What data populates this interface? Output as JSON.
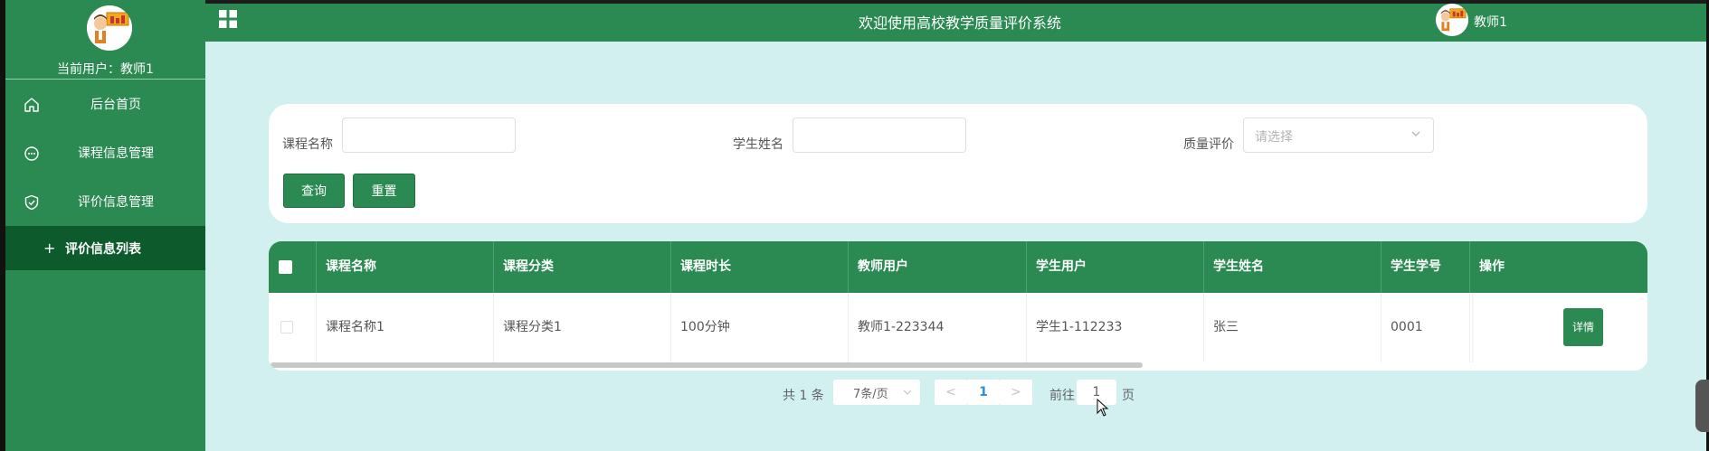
{
  "sidebar": {
    "current_user_label": "当前用户：教师1",
    "items": [
      {
        "label": "后台首页",
        "icon": "home-icon"
      },
      {
        "label": "课程信息管理",
        "icon": "chat-bubble-icon"
      },
      {
        "label": "评价信息管理",
        "icon": "shield-check-icon"
      }
    ],
    "sub_item": {
      "label": "评价信息列表",
      "prefix": "+"
    }
  },
  "header": {
    "title": "欢迎使用高校教学质量评价系统",
    "user_name": "教师1"
  },
  "search": {
    "course_name_label": "课程名称",
    "course_name_value": "",
    "student_name_label": "学生姓名",
    "student_name_value": "",
    "quality_label": "质量评价",
    "quality_placeholder": "请选择",
    "query_button": "查询",
    "reset_button": "重置"
  },
  "table": {
    "columns": [
      "课程名称",
      "课程分类",
      "课程时长",
      "教师用户",
      "学生用户",
      "学生姓名",
      "学生学号",
      "操作"
    ],
    "rows": [
      {
        "course_name": "课程名称1",
        "course_category": "课程分类1",
        "course_duration": "100分钟",
        "teacher_user": "教师1-223344",
        "student_user": "学生1-112233",
        "student_name": "张三",
        "student_no": "0001",
        "action": "详情"
      }
    ]
  },
  "pagination": {
    "total_text": "共 1 条",
    "page_size": "7条/页",
    "prev": "<",
    "current_page": "1",
    "next": ">",
    "goto_label": "前往",
    "goto_value": "1",
    "page_suffix": "页"
  },
  "colors": {
    "primary_green": "#2a8a52",
    "dark_green": "#0d5a2d",
    "main_background": "#d2f0f0",
    "page_link_blue": "#2e8ed9"
  }
}
